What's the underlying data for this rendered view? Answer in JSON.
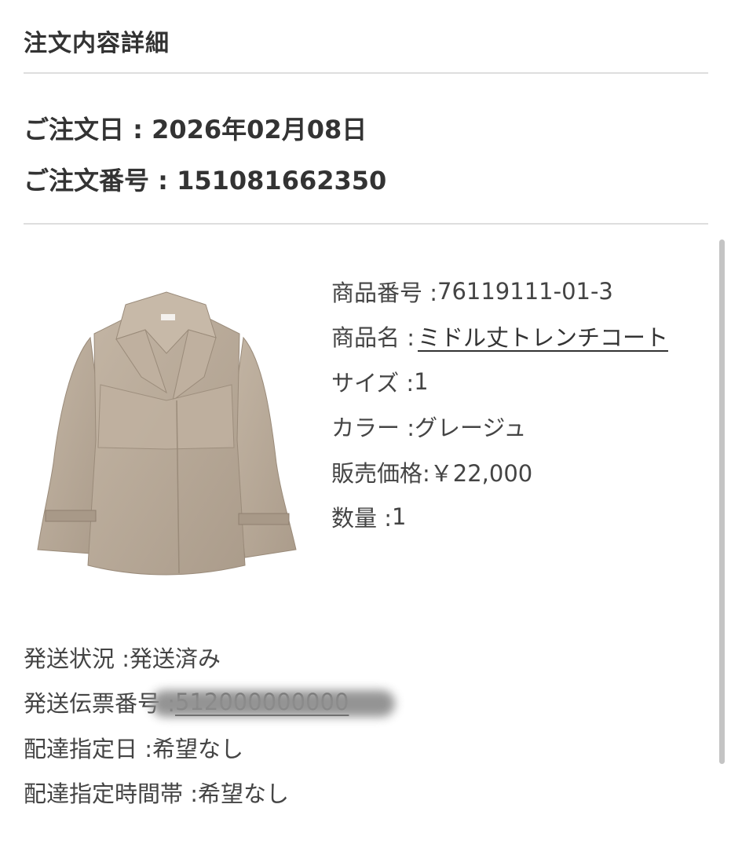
{
  "section_title": "注文内容詳細",
  "order": {
    "date_label": "ご注文日 : ",
    "date_value": "2026年02月08日",
    "number_label": "ご注文番号 : ",
    "number_value": "151081662350"
  },
  "product": {
    "image_alt": "trench-coat-photo",
    "code_label": "商品番号 : ",
    "code_value": "76119111-01-3",
    "name_label": "商品名 : ",
    "name_value": "ミドル丈トレンチコート",
    "size_label": "サイズ : ",
    "size_value": "1",
    "color_label": "カラー : ",
    "color_value": "グレージュ",
    "price_label": "販売価格: ",
    "price_value": "￥22,000",
    "qty_label": "数量 : ",
    "qty_value": "1"
  },
  "shipping": {
    "status_label": "発送状況 : ",
    "status_value": "発送済み",
    "tracking_label": "発送伝票番号 : ",
    "tracking_value": "512000000000",
    "delivery_date_label": "配達指定日 : ",
    "delivery_date_value": "希望なし",
    "delivery_time_label": "配達指定時間帯 : ",
    "delivery_time_value": "希望なし"
  },
  "colors": {
    "coat": "#b9aa99",
    "divider": "#dedede",
    "text": "#3a3a3a"
  }
}
